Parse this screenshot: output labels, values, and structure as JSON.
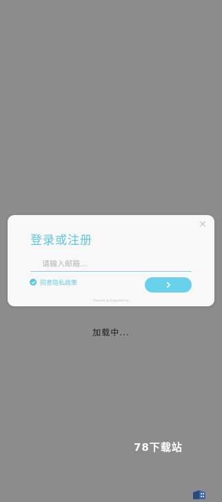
{
  "dialog": {
    "title": "登录或注册",
    "email_placeholder": "请输入邮箱...",
    "email_value": "",
    "agree_label": "同意隐私政策",
    "agree_checked": true,
    "powered_by": "Powered by    Supported by",
    "close_icon": "close-icon",
    "next_icon": "chevron-right-icon"
  },
  "status": {
    "loading_text": "加载中..."
  },
  "watermark": {
    "text": "78下载站"
  },
  "colors": {
    "background": "#8c8c8c",
    "dialog_bg": "#f8f8f8",
    "accent": "#5cc5dc",
    "button": "#67d0ea"
  }
}
